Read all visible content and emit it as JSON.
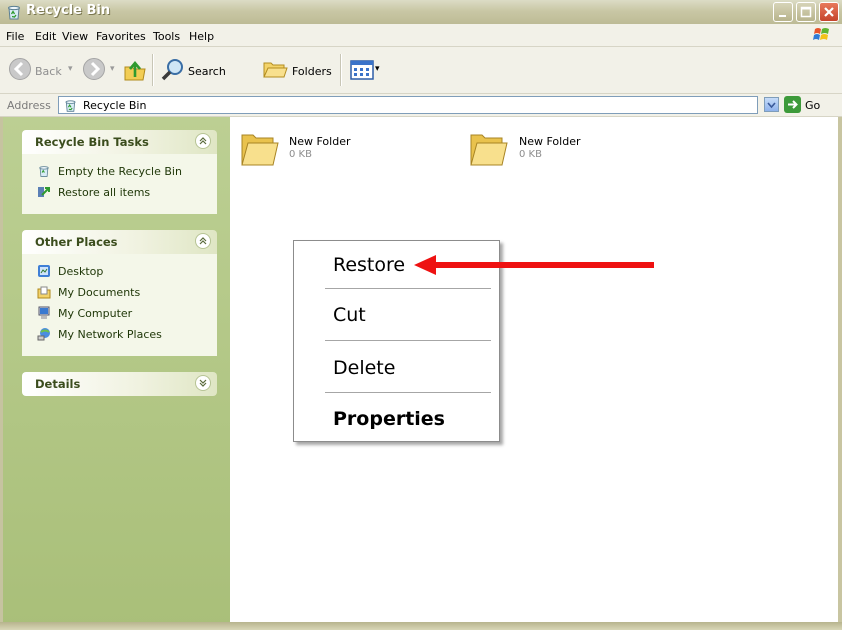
{
  "window": {
    "title": "Recycle Bin"
  },
  "menu": [
    "File",
    "Edit",
    "View",
    "Favorites",
    "Tools",
    "Help"
  ],
  "toolbar": {
    "back": "Back",
    "search": "Search",
    "folders": "Folders"
  },
  "address": {
    "label": "Address",
    "value": "Recycle Bin",
    "go": "Go"
  },
  "panels": {
    "tasks": {
      "title": "Recycle Bin Tasks",
      "items": [
        "Empty the Recycle Bin",
        "Restore all items"
      ]
    },
    "places": {
      "title": "Other Places",
      "items": [
        "Desktop",
        "My Documents",
        "My Computer",
        "My Network Places"
      ]
    },
    "details": {
      "title": "Details"
    }
  },
  "files": [
    {
      "name": "New Folder",
      "size": "0 KB"
    },
    {
      "name": "New Folder",
      "size": "0 KB"
    }
  ],
  "context_menu": {
    "items": [
      "Restore",
      "Cut",
      "Delete",
      "Properties"
    ]
  },
  "colors": {
    "annotation_arrow": "#ee1111",
    "task_pane": "#a9bf79",
    "folder": "#f6d873"
  }
}
